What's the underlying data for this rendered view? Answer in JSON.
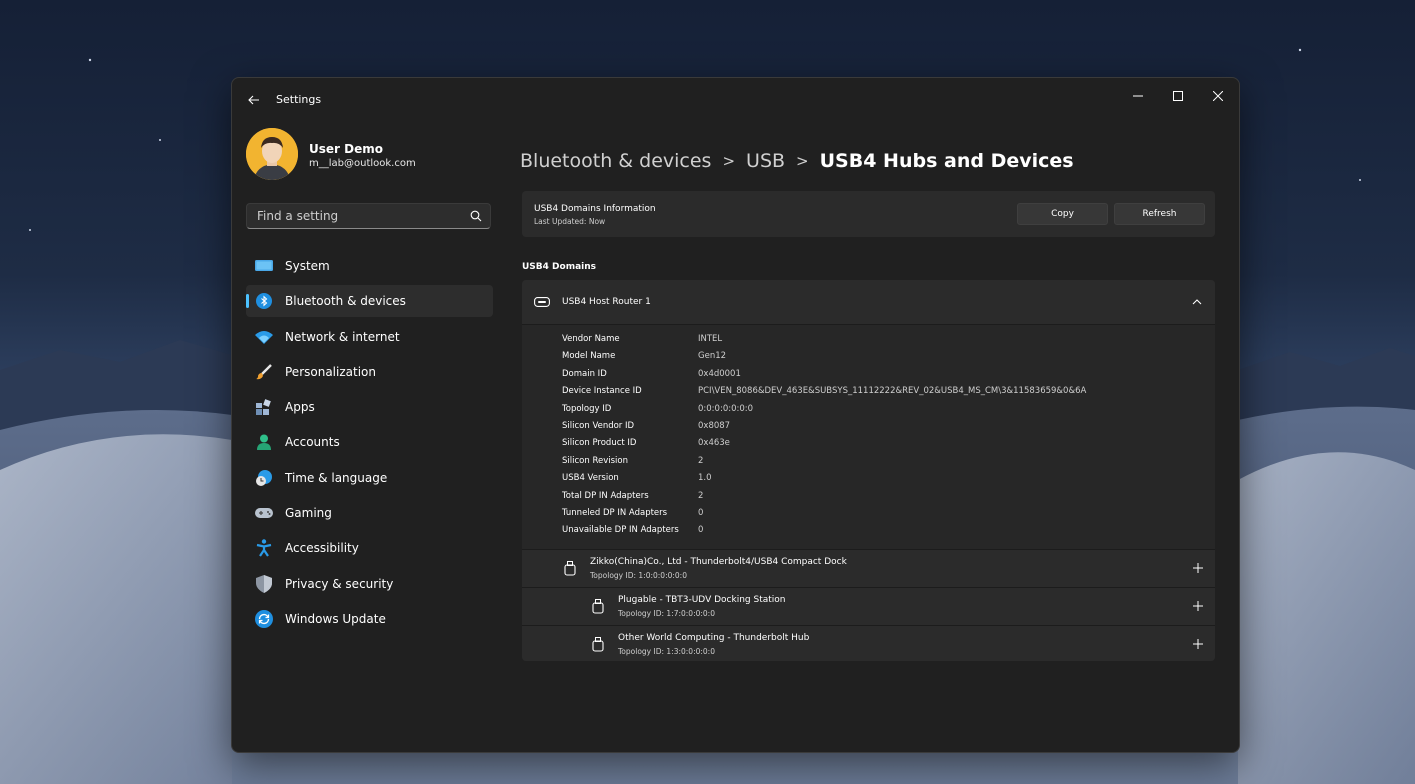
{
  "window": {
    "title": "Settings"
  },
  "user": {
    "name": "User Demo",
    "email": "m__lab@outlook.com"
  },
  "search": {
    "placeholder": "Find a setting"
  },
  "nav": {
    "selected_index": 1,
    "items": [
      {
        "label": "System",
        "icon": "monitor-icon"
      },
      {
        "label": "Bluetooth & devices",
        "icon": "bluetooth-icon"
      },
      {
        "label": "Network & internet",
        "icon": "wifi-icon"
      },
      {
        "label": "Personalization",
        "icon": "brush-icon"
      },
      {
        "label": "Apps",
        "icon": "apps-icon"
      },
      {
        "label": "Accounts",
        "icon": "person-icon"
      },
      {
        "label": "Time & language",
        "icon": "clock-globe-icon"
      },
      {
        "label": "Gaming",
        "icon": "gamepad-icon"
      },
      {
        "label": "Accessibility",
        "icon": "accessibility-icon"
      },
      {
        "label": "Privacy & security",
        "icon": "shield-icon"
      },
      {
        "label": "Windows Update",
        "icon": "update-icon"
      }
    ]
  },
  "breadcrumb": {
    "items": [
      "Bluetooth & devices",
      "USB",
      "USB4 Hubs and Devices"
    ],
    "separator": ">"
  },
  "info_card": {
    "title": "USB4 Domains Information",
    "last_updated": "Last Updated:  Now",
    "copy_label": "Copy",
    "refresh_label": "Refresh"
  },
  "domains": {
    "section_label": "USB4 Domains",
    "router": {
      "title": "USB4 Host Router 1",
      "properties": [
        {
          "key": "Vendor Name",
          "value": "INTEL"
        },
        {
          "key": "Model Name",
          "value": "Gen12"
        },
        {
          "key": "Domain ID",
          "value": "0x4d0001"
        },
        {
          "key": "Device Instance ID",
          "value": "PCI\\VEN_8086&DEV_463E&SUBSYS_11112222&REV_02&USB4_MS_CM\\3&11583659&0&6A"
        },
        {
          "key": "Topology ID",
          "value": "0:0:0:0:0:0:0"
        },
        {
          "key": "Silicon Vendor ID",
          "value": "0x8087"
        },
        {
          "key": "Silicon Product ID",
          "value": "0x463e"
        },
        {
          "key": "Silicon Revision",
          "value": "2"
        },
        {
          "key": "USB4 Version",
          "value": "1.0"
        },
        {
          "key": "Total DP IN Adapters",
          "value": "2"
        },
        {
          "key": "Tunneled DP IN Adapters",
          "value": "0"
        },
        {
          "key": "Unavailable DP IN Adapters",
          "value": "0"
        }
      ],
      "devices": [
        {
          "name": "Zikko(China)Co., Ltd - Thunderbolt4/USB4 Compact Dock",
          "topology": "Topology ID:  1:0:0:0:0:0:0",
          "level": 1
        },
        {
          "name": "Plugable - TBT3-UDV Docking Station",
          "topology": "Topology ID:  1:7:0:0:0:0:0",
          "level": 2
        },
        {
          "name": "Other World Computing - Thunderbolt Hub",
          "topology": "Topology ID:  1:3:0:0:0:0:0",
          "level": 2
        }
      ]
    }
  },
  "colors": {
    "accent": "#4cc2ff",
    "window_bg": "#202020",
    "card_bg": "#2b2b2b"
  }
}
